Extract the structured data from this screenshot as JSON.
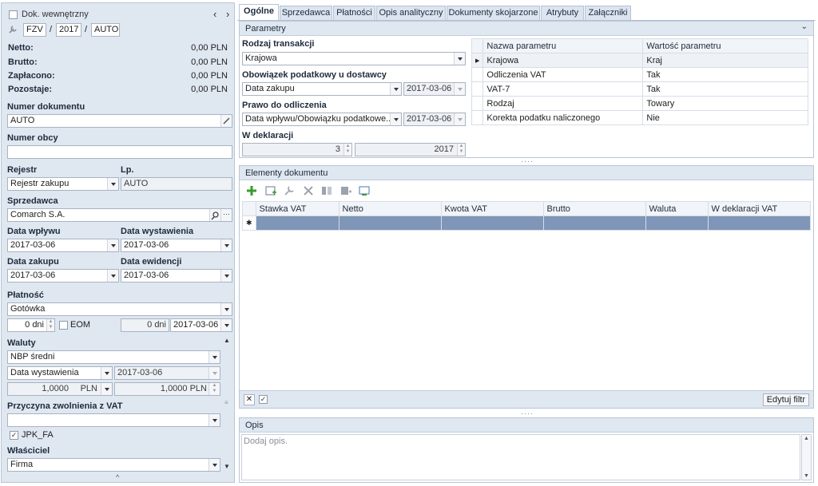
{
  "left": {
    "internal_doc": "Dok. wewnętrzny",
    "doc_type": "FZV",
    "doc_year": "2017",
    "doc_auto": "AUTO",
    "sep": "/",
    "netto_label": "Netto:",
    "netto_value": "0,00 PLN",
    "brutto_label": "Brutto:",
    "brutto_value": "0,00 PLN",
    "paid_label": "Zapłacono:",
    "paid_value": "0,00 PLN",
    "remaining_label": "Pozostaje:",
    "remaining_value": "0,00 PLN",
    "doc_number_label": "Numer dokumentu",
    "doc_number_value": "AUTO",
    "foreign_number_label": "Numer obcy",
    "foreign_number_value": "",
    "register_label": "Rejestr",
    "register_value": "Rejestr zakupu",
    "lp_label": "Lp.",
    "lp_value": "AUTO",
    "seller_label": "Sprzedawca",
    "seller_value": "Comarch S.A.",
    "date_received_label": "Data wpływu",
    "date_received_value": "2017-03-06",
    "date_issued_label": "Data wystawienia",
    "date_issued_value": "2017-03-06",
    "date_purchase_label": "Data zakupu",
    "date_purchase_value": "2017-03-06",
    "date_record_label": "Data ewidencji",
    "date_record_value": "2017-03-06",
    "payment_label": "Płatność",
    "payment_value": "Gotówka",
    "payment_days": "0 dni",
    "eom_label": "EOM",
    "payment_days2": "0 dni",
    "payment_date": "2017-03-06",
    "currency_label": "Waluty",
    "currency_value": "NBP średni",
    "currency_date_type": "Data wystawienia",
    "currency_date": "2017-03-06",
    "rate_value": "1,0000",
    "rate_currency": "PLN",
    "rate_amount": "1,0000 PLN",
    "vat_exempt_label": "Przyczyna zwolnienia z VAT",
    "vat_exempt_value": "",
    "jpk_label": "JPK_FA",
    "jpk_check": "✓",
    "owner_label": "Właściciel",
    "owner_value": "Firma"
  },
  "tabs": [
    "Ogólne",
    "Sprzedawca",
    "Płatności",
    "Opis analityczny",
    "Dokumenty skojarzone",
    "Atrybuty",
    "Załączniki"
  ],
  "params": {
    "title": "Parametry",
    "transaction_type_label": "Rodzaj transakcji",
    "transaction_type_value": "Krajowa",
    "tax_obligation_label": "Obowiązek podatkowy u dostawcy",
    "tax_obligation_value": "Data zakupu",
    "tax_obligation_date": "2017-03-06",
    "deduction_label": "Prawo do odliczenia",
    "deduction_value": "Data wpływu/Obowiązku podatkowe...",
    "deduction_date": "2017-03-06",
    "declaration_label": "W deklaracji",
    "declaration_month": "3",
    "declaration_year": "2017",
    "table_headers": [
      "Nazwa parametru",
      "Wartość parametru"
    ],
    "table_rows": [
      {
        "name": "Krajowa",
        "value": "Kraj"
      },
      {
        "name": "Odliczenia VAT",
        "value": "Tak"
      },
      {
        "name": "VAT-7",
        "value": "Tak"
      },
      {
        "name": "Rodzaj",
        "value": "Towary"
      },
      {
        "name": "Korekta podatku naliczonego",
        "value": "Nie"
      }
    ]
  },
  "elements": {
    "title": "Elementy dokumentu",
    "headers": [
      "Stawka VAT",
      "Netto",
      "Kwota VAT",
      "Brutto",
      "Waluta",
      "W deklaracji VAT"
    ],
    "edit_filter": "Edytuj filtr",
    "filter_check": "✓"
  },
  "description": {
    "title": "Opis",
    "placeholder": "Dodaj opis."
  },
  "colors": {
    "accent": "#2b579a",
    "selected_row": "#7f96b8",
    "add_green": "#3a9a2e"
  }
}
